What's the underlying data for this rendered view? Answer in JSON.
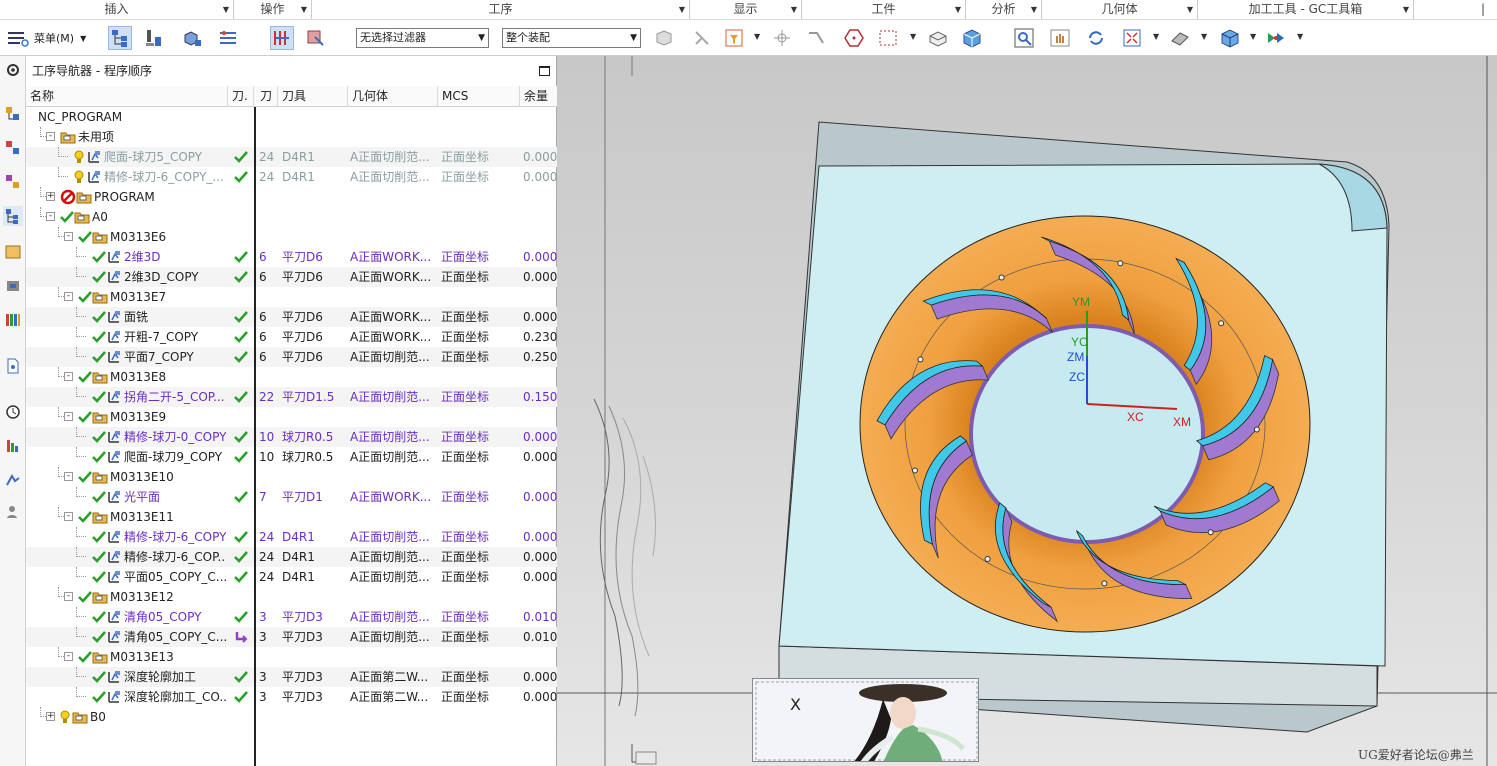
{
  "ribbon": {
    "groups": [
      "插入",
      "操作",
      "工序",
      "显示",
      "工件",
      "分析",
      "几何体",
      "加工工具 - GC工具箱",
      "|"
    ]
  },
  "toolbar": {
    "menu_label": "菜单(M)",
    "filter_select": "无选择过滤器",
    "assembly_select": "整个装配"
  },
  "navigator": {
    "title": "工序导航器 - 程序顺序",
    "columns": [
      "名称",
      "刀.",
      "刀",
      "刀具",
      "几何体",
      "MCS",
      "余量"
    ],
    "rows": [
      {
        "name": "NC_PROGRAM",
        "type": "root",
        "level": 0,
        "check": "",
        "tool_no": "",
        "tool": "",
        "geometry": "",
        "mcs": "",
        "stock": "",
        "color": "normal"
      },
      {
        "name": "未用项",
        "type": "folder",
        "level": 1,
        "expander": "-",
        "check": "",
        "tool_no": "",
        "tool": "",
        "geometry": "",
        "mcs": "",
        "stock": "",
        "color": "normal"
      },
      {
        "name": "爬面-球刀5_COPY",
        "type": "op",
        "level": 2,
        "warn": true,
        "check": "ok",
        "tool_no": "24",
        "tool": "D4R1",
        "geometry": "A正面切削范...",
        "mcs": "正面坐标",
        "stock": "0.000",
        "color": "gray"
      },
      {
        "name": "精修-球刀-6_COPY_...",
        "type": "op",
        "level": 2,
        "warn": true,
        "check": "ok",
        "tool_no": "24",
        "tool": "D4R1",
        "geometry": "A正面切削范...",
        "mcs": "正面坐标",
        "stock": "0.000",
        "color": "gray"
      },
      {
        "name": "PROGRAM",
        "type": "group-prohibited",
        "level": 1,
        "expander": "+",
        "check": "",
        "tool_no": "",
        "tool": "",
        "geometry": "",
        "mcs": "",
        "stock": "",
        "color": "normal"
      },
      {
        "name": "A0",
        "type": "group",
        "level": 1,
        "expander": "-",
        "check": "",
        "tool_no": "",
        "tool": "",
        "geometry": "",
        "mcs": "",
        "stock": "",
        "color": "normal"
      },
      {
        "name": "M0313E6",
        "type": "group",
        "level": 2,
        "expander": "-",
        "check": "",
        "tool_no": "",
        "tool": "",
        "geometry": "",
        "mcs": "",
        "stock": "",
        "color": "normal"
      },
      {
        "name": "2维3D",
        "type": "op",
        "level": 3,
        "check": "ok",
        "tool_no": "6",
        "tool": "平刀D6",
        "geometry": "A正面WORK...",
        "mcs": "正面坐标",
        "stock": "0.000",
        "color": "purple"
      },
      {
        "name": "2维3D_COPY",
        "type": "op",
        "level": 3,
        "check": "ok",
        "tool_no": "6",
        "tool": "平刀D6",
        "geometry": "A正面WORK...",
        "mcs": "正面坐标",
        "stock": "0.000",
        "color": "normal"
      },
      {
        "name": "M0313E7",
        "type": "group",
        "level": 2,
        "expander": "-",
        "check": "",
        "tool_no": "",
        "tool": "",
        "geometry": "",
        "mcs": "",
        "stock": "",
        "color": "normal"
      },
      {
        "name": "面铣",
        "type": "op",
        "level": 3,
        "check": "ok",
        "tool_no": "6",
        "tool": "平刀D6",
        "geometry": "A正面WORK...",
        "mcs": "正面坐标",
        "stock": "0.000",
        "color": "normal"
      },
      {
        "name": "开粗-7_COPY",
        "type": "op",
        "level": 3,
        "check": "ok",
        "tool_no": "6",
        "tool": "平刀D6",
        "geometry": "A正面WORK...",
        "mcs": "正面坐标",
        "stock": "0.230",
        "color": "normal"
      },
      {
        "name": "平面7_COPY",
        "type": "op",
        "level": 3,
        "check": "ok",
        "tool_no": "6",
        "tool": "平刀D6",
        "geometry": "A正面切削范...",
        "mcs": "正面坐标",
        "stock": "0.250",
        "color": "normal"
      },
      {
        "name": "M0313E8",
        "type": "group",
        "level": 2,
        "expander": "-",
        "check": "",
        "tool_no": "",
        "tool": "",
        "geometry": "",
        "mcs": "",
        "stock": "",
        "color": "normal"
      },
      {
        "name": "拐角二开-5_COP...",
        "type": "op",
        "level": 3,
        "check": "ok",
        "tool_no": "22",
        "tool": "平刀D1.5",
        "geometry": "A正面切削范...",
        "mcs": "正面坐标",
        "stock": "0.150",
        "color": "purple"
      },
      {
        "name": "M0313E9",
        "type": "group",
        "level": 2,
        "expander": "-",
        "check": "",
        "tool_no": "",
        "tool": "",
        "geometry": "",
        "mcs": "",
        "stock": "",
        "color": "normal"
      },
      {
        "name": "精修-球刀-0_COPY",
        "type": "op",
        "level": 3,
        "check": "ok",
        "tool_no": "10",
        "tool": "球刀R0.5",
        "geometry": "A正面切削范...",
        "mcs": "正面坐标",
        "stock": "0.000",
        "color": "purple"
      },
      {
        "name": "爬面-球刀9_COPY",
        "type": "op",
        "level": 3,
        "check": "ok",
        "tool_no": "10",
        "tool": "球刀R0.5",
        "geometry": "A正面切削范...",
        "mcs": "正面坐标",
        "stock": "0.000",
        "color": "normal"
      },
      {
        "name": "M0313E10",
        "type": "group",
        "level": 2,
        "expander": "-",
        "check": "",
        "tool_no": "",
        "tool": "",
        "geometry": "",
        "mcs": "",
        "stock": "",
        "color": "normal"
      },
      {
        "name": "光平面",
        "type": "op",
        "level": 3,
        "check": "ok",
        "tool_no": "7",
        "tool": "平刀D1",
        "geometry": "A正面WORK...",
        "mcs": "正面坐标",
        "stock": "0.000",
        "color": "purple"
      },
      {
        "name": "M0313E11",
        "type": "group",
        "level": 2,
        "expander": "-",
        "check": "",
        "tool_no": "",
        "tool": "",
        "geometry": "",
        "mcs": "",
        "stock": "",
        "color": "normal"
      },
      {
        "name": "精修-球刀-6_COPY",
        "type": "op",
        "level": 3,
        "check": "ok",
        "tool_no": "24",
        "tool": "D4R1",
        "geometry": "A正面切削范...",
        "mcs": "正面坐标",
        "stock": "0.000",
        "color": "purple"
      },
      {
        "name": "精修-球刀-6_COP...",
        "type": "op",
        "level": 3,
        "check": "ok",
        "tool_no": "24",
        "tool": "D4R1",
        "geometry": "A正面切削范...",
        "mcs": "正面坐标",
        "stock": "0.000",
        "color": "normal"
      },
      {
        "name": "平面05_COPY_C...",
        "type": "op",
        "level": 3,
        "check": "ok",
        "tool_no": "24",
        "tool": "D4R1",
        "geometry": "A正面切削范...",
        "mcs": "正面坐标",
        "stock": "0.000",
        "color": "normal"
      },
      {
        "name": "M0313E12",
        "type": "group",
        "level": 2,
        "expander": "-",
        "check": "",
        "tool_no": "",
        "tool": "",
        "geometry": "",
        "mcs": "",
        "stock": "",
        "color": "normal"
      },
      {
        "name": "清角05_COPY",
        "type": "op",
        "level": 3,
        "check": "ok",
        "tool_no": "3",
        "tool": "平刀D3",
        "geometry": "A正面切削范...",
        "mcs": "正面坐标",
        "stock": "0.010",
        "color": "purple"
      },
      {
        "name": "清角05_COPY_C...",
        "type": "op",
        "level": 3,
        "check": "arrow",
        "tool_no": "3",
        "tool": "平刀D3",
        "geometry": "A正面切削范...",
        "mcs": "正面坐标",
        "stock": "0.010",
        "color": "normal"
      },
      {
        "name": "M0313E13",
        "type": "group",
        "level": 2,
        "expander": "-",
        "check": "",
        "tool_no": "",
        "tool": "",
        "geometry": "",
        "mcs": "",
        "stock": "",
        "color": "normal"
      },
      {
        "name": "深度轮廓加工",
        "type": "op",
        "level": 3,
        "check": "ok",
        "tool_no": "3",
        "tool": "平刀D3",
        "geometry": "A正面第二W...",
        "mcs": "正面坐标",
        "stock": "0.000",
        "color": "normal"
      },
      {
        "name": "深度轮廓加工_CO...",
        "type": "op",
        "level": 3,
        "check": "ok",
        "tool_no": "3",
        "tool": "平刀D3",
        "geometry": "A正面第二W...",
        "mcs": "正面坐标",
        "stock": "0.000",
        "color": "normal"
      },
      {
        "name": "B0",
        "type": "group-warn",
        "level": 1,
        "expander": "+",
        "check": "",
        "tool_no": "",
        "tool": "",
        "geometry": "",
        "mcs": "",
        "stock": "",
        "color": "normal"
      }
    ]
  },
  "viewport": {
    "axis_labels": {
      "ym": "YM",
      "yc": "YC",
      "zm": "ZM",
      "zc": "ZC",
      "xc": "XC",
      "xm": "XM"
    }
  },
  "popup": {
    "close_label": "X"
  },
  "watermark": "UG爱好者论坛@弗兰",
  "colors": {
    "orange": "#f0a040",
    "cyan": "#40c8e8",
    "violet": "#a07ad0",
    "plate": "#cfeef2",
    "purple_text": "#6a2fc0",
    "green_check": "#2aa02a"
  }
}
